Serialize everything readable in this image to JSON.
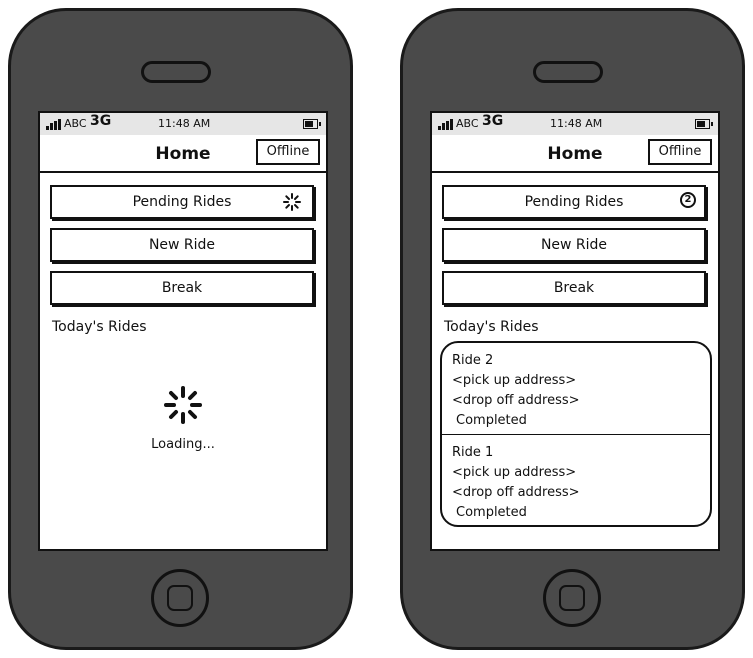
{
  "status_bar": {
    "carrier": "ABC",
    "network": "3G",
    "time": "11:48 AM"
  },
  "nav": {
    "title": "Home",
    "offline_label": "Offline"
  },
  "buttons": {
    "pending": "Pending Rides",
    "new_ride": "New Ride",
    "break": "Break"
  },
  "section_label": "Today's Rides",
  "left_screen": {
    "loading_text": "Loading..."
  },
  "right_screen": {
    "pending_count": "2",
    "rides": [
      {
        "title": "Ride 2",
        "pickup": "<pick up address>",
        "dropoff": "<drop off address>",
        "status": "Completed"
      },
      {
        "title": "Ride 1",
        "pickup": "<pick up address>",
        "dropoff": "<drop off address>",
        "status": "Completed"
      }
    ]
  },
  "icons": {
    "speaker": "speaker-slot-icon",
    "home_button": "home-button-icon",
    "signal": "signal-bars-icon",
    "battery": "battery-icon",
    "spinner": "loading-spinner-icon"
  }
}
